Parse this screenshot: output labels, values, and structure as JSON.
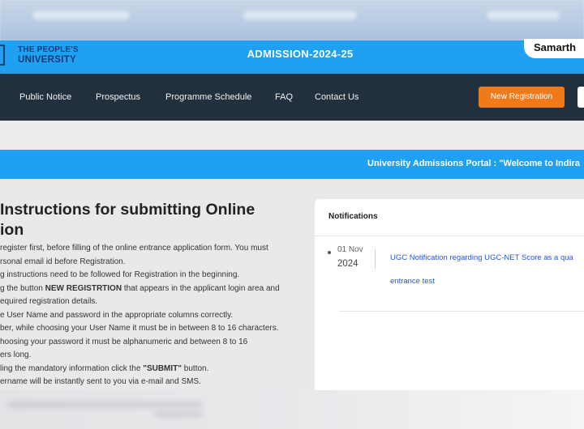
{
  "header": {
    "logo_line1": "THE PEOPLE'S",
    "logo_line2": "UNIVERSITY",
    "title": "ADMISSION-2024-25",
    "brand": "Samarth"
  },
  "nav": {
    "items": [
      {
        "label": "Public Notice"
      },
      {
        "label": "Prospectus"
      },
      {
        "label": "Programme Schedule"
      },
      {
        "label": "FAQ"
      },
      {
        "label": "Contact Us"
      }
    ],
    "new_registration": "New Registration"
  },
  "marquee": {
    "text": "University Admissions Portal : \"Welcome to Indira"
  },
  "instructions": {
    "title_line1": "Instructions for submitting Online",
    "title_line2": "ion",
    "lines": [
      {
        "text": "register first, before filling of the online entrance application form. You must"
      },
      {
        "text": "rsonal email id before Registration."
      },
      {
        "text": "g instructions need to be followed for Registration in the beginning."
      },
      {
        "pre": "g the button ",
        "strong": "NEW REGISTRTION",
        "post": " that appears in the applicant login area and"
      },
      {
        "text": "equired registration details."
      },
      {
        "text": "e User Name and password in the appropriate columns correctly."
      },
      {
        "text": "ber, while choosing your User Name it must be in between 8 to 16 characters."
      },
      {
        "text": "hoosing your password it must be alphanumeric and between 8 to 16"
      },
      {
        "text": "ers long."
      },
      {
        "pre": "ling the mandatory information click the ",
        "strong": "\"SUBMIT\"",
        "post": " button."
      },
      {
        "text": "ername will be instantly sent to you via e-mail and SMS."
      }
    ]
  },
  "notifications": {
    "heading": "Notifications",
    "items": [
      {
        "date_day": "01 Nov",
        "date_year": "2024",
        "text_line1": "UGC Notification regarding UGC-NET Score as a qua",
        "text_line2": "entrance test"
      }
    ]
  },
  "colors": {
    "accent_blue": "#1fa0f0",
    "nav_dark": "#222f3d",
    "cta_orange": "#f07a1a",
    "link_blue": "#2a58c8"
  }
}
